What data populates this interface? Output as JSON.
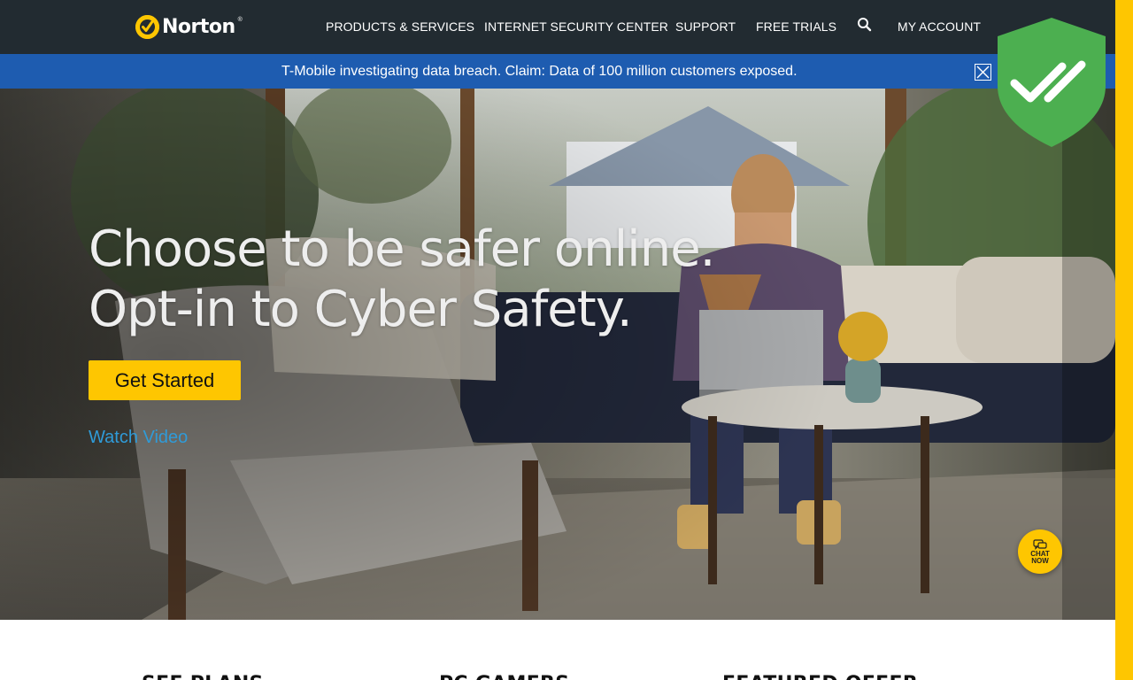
{
  "header": {
    "logo_text": "Norton",
    "logo_tm": "®",
    "nav": [
      {
        "label": "PRODUCTS & SERVICES"
      },
      {
        "label": "INTERNET SECURITY CENTER"
      },
      {
        "label": "SUPPORT"
      },
      {
        "label": "FREE TRIALS"
      },
      {
        "label": "MY ACCOUNT"
      }
    ],
    "search_icon": "search-icon"
  },
  "alert": {
    "text": "T-Mobile investigating data breach. Claim: Data of 100 million customers exposed.",
    "close_icon": "close-icon"
  },
  "hero": {
    "line1": "Choose to be safer online.",
    "line2": "Opt-in to Cyber Safety.",
    "cta_label": "Get Started",
    "watch_label": "Watch Video"
  },
  "chat": {
    "label": "CHAT NOW",
    "icon": "chat-bubble-icon"
  },
  "shield": {
    "icon": "double-check-shield-icon",
    "color": "#4caf50"
  },
  "sections": [
    {
      "heading": "SEE PLANS"
    },
    {
      "heading": "PC GAMERS"
    },
    {
      "heading": "FEATURED OFFER"
    }
  ],
  "colors": {
    "nav_bg": "#222b31",
    "alert_bg": "#1e5cb0",
    "brand_yellow": "#fec601",
    "link_blue": "#2f9bd8"
  }
}
